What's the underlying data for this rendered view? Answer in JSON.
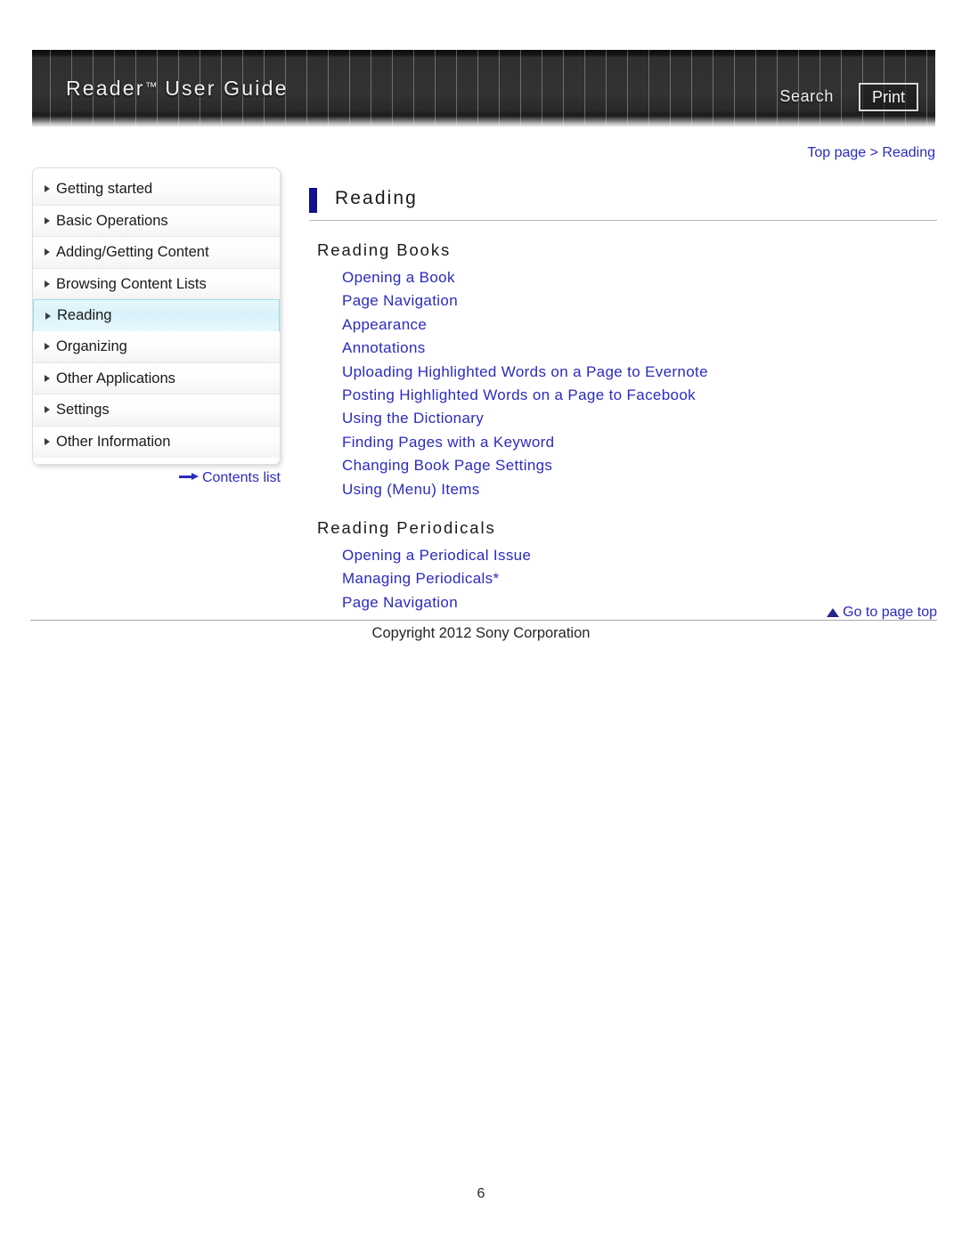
{
  "header": {
    "title": "Reader",
    "title_tm": "™",
    "title_rest": " User Guide",
    "search_label": "Search",
    "print_label": "Print"
  },
  "breadcrumb": {
    "text": "Top page > Reading"
  },
  "sidebar": {
    "items": [
      {
        "label": "Getting started",
        "active": false
      },
      {
        "label": "Basic Operations",
        "active": false
      },
      {
        "label": "Adding/Getting Content",
        "active": false
      },
      {
        "label": "Browsing Content Lists",
        "active": false
      },
      {
        "label": "Reading",
        "active": true
      },
      {
        "label": "Organizing",
        "active": false
      },
      {
        "label": "Other Applications",
        "active": false
      },
      {
        "label": "Settings",
        "active": false
      },
      {
        "label": "Other Information",
        "active": false
      }
    ],
    "contents_list_label": "Contents list"
  },
  "main": {
    "page_title": "Reading",
    "sections": [
      {
        "title": "Reading Books",
        "links": [
          "Opening a Book",
          "Page Navigation",
          "Appearance",
          "Annotations",
          "Uploading Highlighted Words on a Page to Evernote",
          "Posting Highlighted Words on a Page to Facebook",
          "Using the Dictionary",
          "Finding Pages with a Keyword",
          "Changing Book Page Settings",
          "Using (Menu) Items"
        ]
      },
      {
        "title": "Reading Periodicals",
        "links": [
          "Opening a Periodical Issue",
          "Managing Periodicals*",
          "Page Navigation"
        ]
      }
    ]
  },
  "footer": {
    "go_to_top_label": "Go to page top",
    "copyright": "Copyright 2012 Sony Corporation",
    "page_number": "6"
  },
  "colors": {
    "link_blue": "#2b2bbf",
    "title_bar_blue": "#101090",
    "active_nav_bg": "#d9f2fa",
    "active_nav_border": "#9adced",
    "banner_dark": "#333333"
  }
}
